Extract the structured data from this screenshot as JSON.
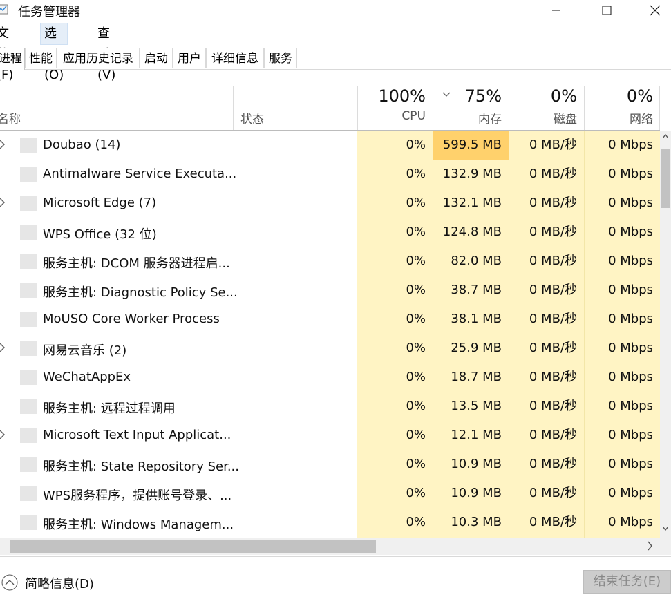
{
  "window": {
    "title": "任务管理器"
  },
  "menu": {
    "file": "文件(F)",
    "options": "选项(O)",
    "view": "查看(V)"
  },
  "tabs": [
    {
      "label": "进程"
    },
    {
      "label": "性能"
    },
    {
      "label": "应用历史记录"
    },
    {
      "label": "启动"
    },
    {
      "label": "用户"
    },
    {
      "label": "详细信息"
    },
    {
      "label": "服务"
    }
  ],
  "columns": {
    "name": "名称",
    "status": "状态",
    "cpu": {
      "percent": "100%",
      "label": "CPU"
    },
    "memory": {
      "percent": "75%",
      "label": "内存"
    },
    "disk": {
      "percent": "0%",
      "label": "磁盘"
    },
    "network": {
      "percent": "0%",
      "label": "网络"
    }
  },
  "processes": [
    {
      "name": "Doubao (14)",
      "expandable": true,
      "cpu": "0%",
      "memory": "599.5 MB",
      "disk": "0 MB/秒",
      "network": "0 Mbps"
    },
    {
      "name": "Antimalware Service Executa...",
      "expandable": false,
      "cpu": "0%",
      "memory": "132.9 MB",
      "disk": "0 MB/秒",
      "network": "0 Mbps"
    },
    {
      "name": "Microsoft Edge (7)",
      "expandable": true,
      "cpu": "0%",
      "memory": "132.1 MB",
      "disk": "0 MB/秒",
      "network": "0 Mbps"
    },
    {
      "name": "WPS Office (32 位)",
      "expandable": false,
      "cpu": "0%",
      "memory": "124.8 MB",
      "disk": "0 MB/秒",
      "network": "0 Mbps"
    },
    {
      "name": "服务主机: DCOM 服务器进程启...",
      "expandable": false,
      "cpu": "0%",
      "memory": "82.0 MB",
      "disk": "0 MB/秒",
      "network": "0 Mbps"
    },
    {
      "name": "服务主机: Diagnostic Policy Se...",
      "expandable": false,
      "cpu": "0%",
      "memory": "38.7 MB",
      "disk": "0 MB/秒",
      "network": "0 Mbps"
    },
    {
      "name": "MoUSO Core Worker Process",
      "expandable": false,
      "cpu": "0%",
      "memory": "38.1 MB",
      "disk": "0 MB/秒",
      "network": "0 Mbps"
    },
    {
      "name": "网易云音乐 (2)",
      "expandable": true,
      "cpu": "0%",
      "memory": "25.9 MB",
      "disk": "0 MB/秒",
      "network": "0 Mbps"
    },
    {
      "name": "WeChatAppEx",
      "expandable": false,
      "cpu": "0%",
      "memory": "18.7 MB",
      "disk": "0 MB/秒",
      "network": "0 Mbps"
    },
    {
      "name": "服务主机: 远程过程调用",
      "expandable": false,
      "cpu": "0%",
      "memory": "13.5 MB",
      "disk": "0 MB/秒",
      "network": "0 Mbps"
    },
    {
      "name": "Microsoft Text Input Applicat...",
      "expandable": true,
      "cpu": "0%",
      "memory": "12.1 MB",
      "disk": "0 MB/秒",
      "network": "0 Mbps"
    },
    {
      "name": "服务主机: State Repository Ser...",
      "expandable": false,
      "cpu": "0%",
      "memory": "10.9 MB",
      "disk": "0 MB/秒",
      "network": "0 Mbps"
    },
    {
      "name": "WPS服务程序，提供账号登录、...",
      "expandable": false,
      "cpu": "0%",
      "memory": "10.9 MB",
      "disk": "0 MB/秒",
      "network": "0 Mbps"
    },
    {
      "name": "服务主机: Windows Managem...",
      "expandable": false,
      "cpu": "0%",
      "memory": "10.3 MB",
      "disk": "0 MB/秒",
      "network": "0 Mbps"
    }
  ],
  "footer": {
    "fewer_details": "简略信息(D)",
    "end_task": "结束任务(E)"
  },
  "colors": {
    "column_bg": "#fff4c4",
    "memory_top_bg": "#ffd16c",
    "disabled_button": "#cccccc"
  }
}
